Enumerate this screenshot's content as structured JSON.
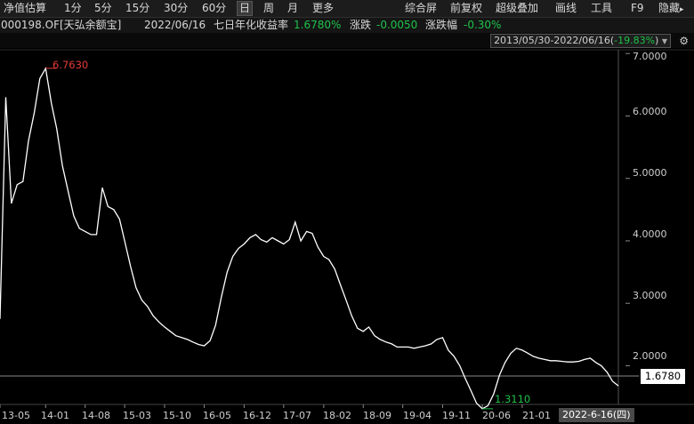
{
  "toolbar": {
    "left_items": [
      "净值估算",
      "1分",
      "5分",
      "15分",
      "30分",
      "60分",
      "日",
      "周",
      "月",
      "更多"
    ],
    "selected": "日",
    "right_items": [
      "综合屏",
      "前复权",
      "超级叠加",
      "画线",
      "工具",
      "F9",
      "隐藏"
    ],
    "hide_arrow": "▸"
  },
  "info": {
    "code_name": "000198.OF[天弘余额宝]",
    "date": "2022/06/16",
    "yield_label": "七日年化收益率",
    "yield_value": "1.6780%",
    "change_label": "涨跌",
    "change_value": "-0.0050",
    "pct_label": "涨跌幅",
    "pct_value": "-0.30%"
  },
  "range": {
    "text": "2013/05/30-2022/06/16(",
    "pct": "-19.83%",
    "close": ")",
    "dropdown_icon": "triangle-down-icon",
    "settings_icon": "gear-icon"
  },
  "chart_data": {
    "type": "line",
    "x_tick_labels": [
      "13-05",
      "14-01",
      "14-08",
      "15-03",
      "15-10",
      "16-05",
      "16-12",
      "17-07",
      "18-02",
      "18-09",
      "19-04",
      "19-11",
      "20-06",
      "21-01"
    ],
    "y_tick_labels": [
      "7.0000",
      "6.0000",
      "5.0000",
      "4.0000",
      "3.0000",
      "2.0000"
    ],
    "ylim": [
      1.38,
      7.06
    ],
    "series": [
      {
        "x": [
          "2013-05",
          "2013-06",
          "2013-07",
          "2013-08",
          "2013-09",
          "2013-10",
          "2013-11",
          "2013-12",
          "2014-01",
          "2014-02",
          "2014-03",
          "2014-04",
          "2014-05",
          "2014-06",
          "2014-07",
          "2014-08",
          "2014-09",
          "2014-10",
          "2014-11",
          "2014-12",
          "2015-01",
          "2015-02",
          "2015-03",
          "2015-04",
          "2015-05",
          "2015-06",
          "2015-07",
          "2015-08",
          "2015-09",
          "2015-10",
          "2015-11",
          "2015-12",
          "2016-01",
          "2016-02",
          "2016-03",
          "2016-04",
          "2016-05",
          "2016-06",
          "2016-07",
          "2016-08",
          "2016-09",
          "2016-10",
          "2016-11",
          "2016-12",
          "2017-01",
          "2017-02",
          "2017-03",
          "2017-04",
          "2017-05",
          "2017-06",
          "2017-07",
          "2017-08",
          "2017-09",
          "2017-10",
          "2017-11",
          "2017-12",
          "2018-01",
          "2018-02",
          "2018-03",
          "2018-04",
          "2018-05",
          "2018-06",
          "2018-07",
          "2018-08",
          "2018-09",
          "2018-10",
          "2018-11",
          "2018-12",
          "2019-01",
          "2019-02",
          "2019-03",
          "2019-04",
          "2019-05",
          "2019-06",
          "2019-07",
          "2019-08",
          "2019-09",
          "2019-10",
          "2019-11",
          "2019-12",
          "2020-01",
          "2020-02",
          "2020-03",
          "2020-04",
          "2020-05",
          "2020-06",
          "2020-07",
          "2020-08",
          "2020-09",
          "2020-10",
          "2020-11",
          "2020-12",
          "2021-01",
          "2021-02",
          "2021-03",
          "2021-04",
          "2021-05",
          "2021-06",
          "2021-07",
          "2021-08",
          "2021-09",
          "2021-10",
          "2021-11",
          "2021-12",
          "2022-01",
          "2022-02",
          "2022-03",
          "2022-04",
          "2022-05",
          "2022-06"
        ],
        "y": [
          2.75,
          6.3,
          4.6,
          4.9,
          4.95,
          5.6,
          6.05,
          6.6,
          6.763,
          6.2,
          5.8,
          5.2,
          4.8,
          4.4,
          4.2,
          4.15,
          4.1,
          4.1,
          4.85,
          4.55,
          4.5,
          4.35,
          4.0,
          3.6,
          3.25,
          3.05,
          2.95,
          2.8,
          2.7,
          2.62,
          2.55,
          2.48,
          2.45,
          2.42,
          2.38,
          2.34,
          2.32,
          2.4,
          2.65,
          3.1,
          3.5,
          3.75,
          3.88,
          3.95,
          4.05,
          4.1,
          4.02,
          3.98,
          4.05,
          4.0,
          3.95,
          4.02,
          4.3,
          4.0,
          4.15,
          4.12,
          3.9,
          3.75,
          3.7,
          3.55,
          3.3,
          3.05,
          2.8,
          2.6,
          2.55,
          2.62,
          2.48,
          2.42,
          2.38,
          2.35,
          2.3,
          2.3,
          2.3,
          2.28,
          2.3,
          2.32,
          2.35,
          2.42,
          2.45,
          2.25,
          2.15,
          2.0,
          1.8,
          1.6,
          1.4,
          1.311,
          1.36,
          1.55,
          1.85,
          2.05,
          2.2,
          2.28,
          2.25,
          2.2,
          2.15,
          2.12,
          2.1,
          2.08,
          2.08,
          2.07,
          2.06,
          2.06,
          2.07,
          2.1,
          2.12,
          2.05,
          2.0,
          1.9,
          1.75,
          1.678
        ]
      }
    ],
    "annotations": {
      "max_label": "6.7630",
      "min_label": "1.3110",
      "current_value_label": "1.6780",
      "cursor_date_label": "2022-6-16(四)"
    },
    "colors": {
      "line": "#ffffff",
      "max": "#e53a3a",
      "min": "#1ec24a",
      "background": "#000000"
    }
  }
}
